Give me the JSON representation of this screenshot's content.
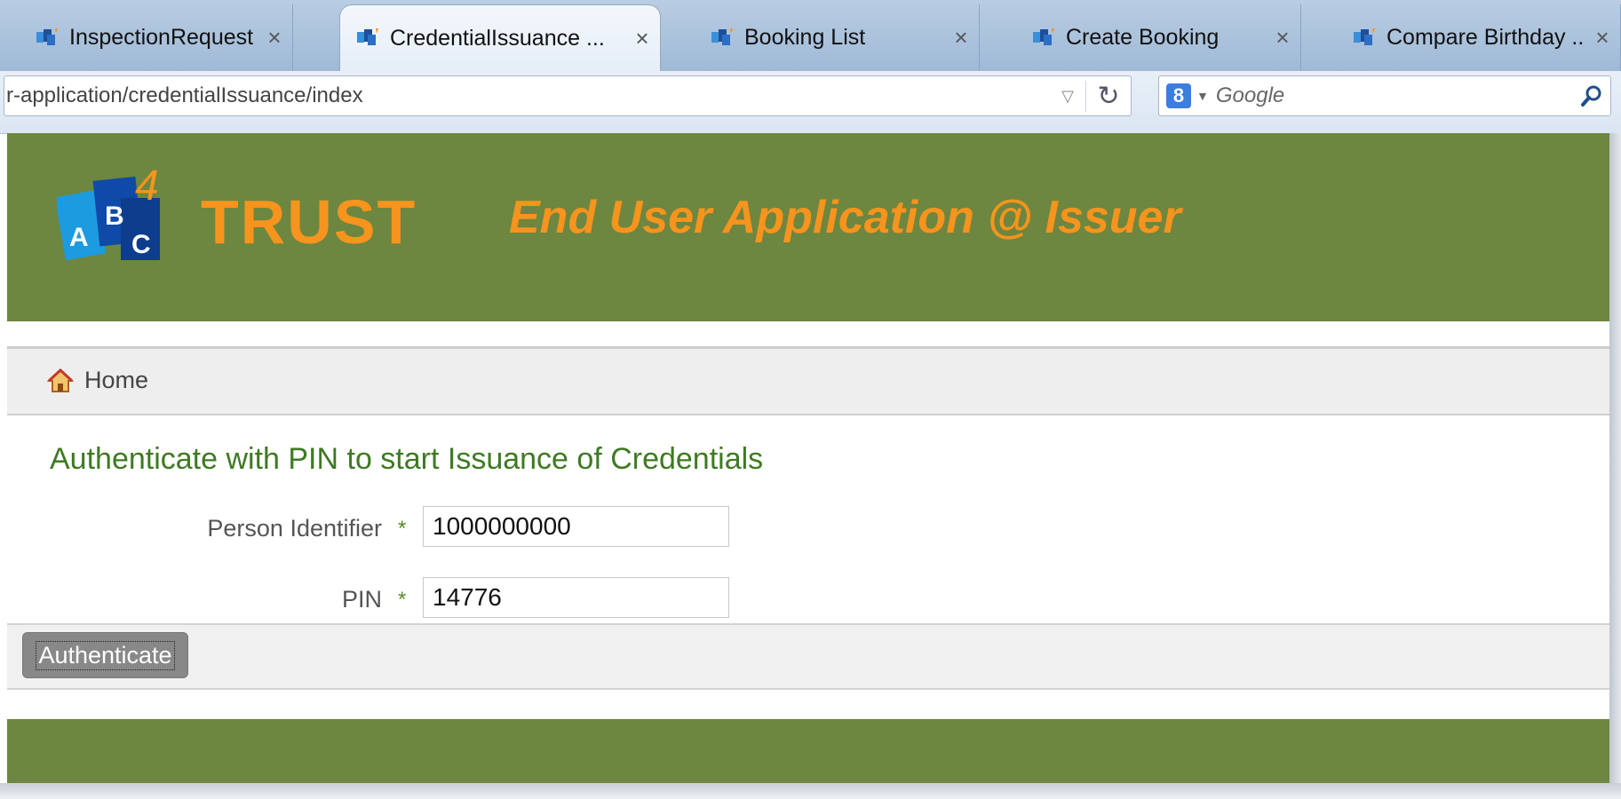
{
  "browser": {
    "tabs": [
      {
        "title": "InspectionRequest ...",
        "active": false,
        "close": "×"
      },
      {
        "title": "CredentialIssuance ...",
        "active": true,
        "close": "×"
      },
      {
        "title": "Booking List",
        "active": false,
        "close": "×"
      },
      {
        "title": "Create Booking",
        "active": false,
        "close": "×"
      },
      {
        "title": "Compare Birthday ...",
        "active": false,
        "close": "×"
      }
    ],
    "url": "r-application/credentialIssuance/index",
    "search": {
      "engine_glyph": "8",
      "placeholder": "Google"
    }
  },
  "header": {
    "logo_letters": [
      "A",
      "B",
      "C",
      "4"
    ],
    "logo_text": "TRUST",
    "app_title": "End User Application @ Issuer"
  },
  "breadcrumb": {
    "home_label": "Home",
    "icon": "home-icon"
  },
  "form": {
    "title": "Authenticate with PIN to start Issuance of Credentials",
    "required_mark": "*",
    "fields": [
      {
        "label": "Person Identifier",
        "value": "1000000000"
      },
      {
        "label": "PIN",
        "value": "14776"
      }
    ],
    "submit_label": "Authenticate"
  },
  "colors": {
    "header_green": "#6d8640",
    "accent_orange": "#f7941d",
    "title_green": "#3e7a22",
    "button_gray": "#888888"
  }
}
